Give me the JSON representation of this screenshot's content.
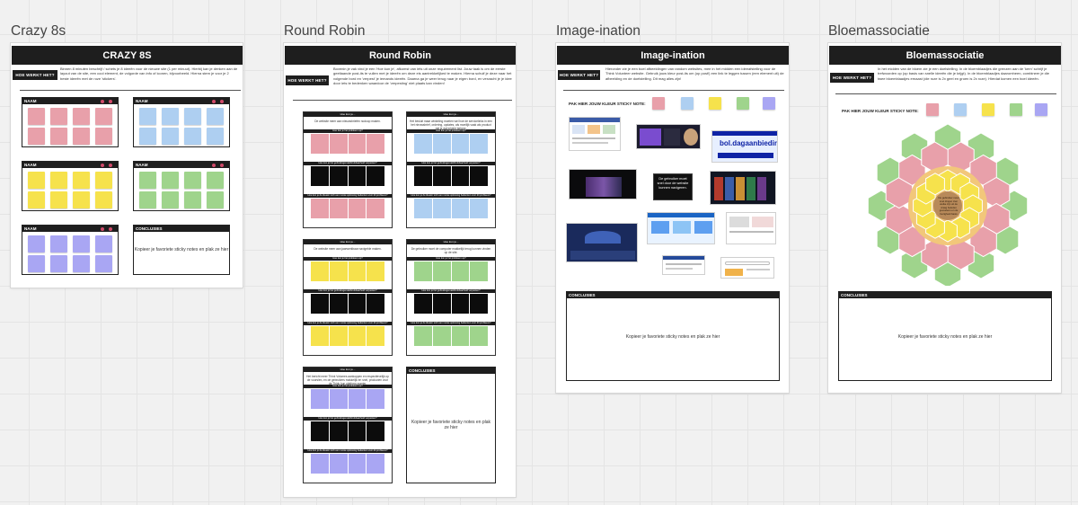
{
  "frames": {
    "crazy8s": {
      "title": "Crazy 8s",
      "header": "CRAZY 8S",
      "how_label": "HOE WERKT HET?",
      "description": "Binnen 8 minuten beschrijf / schets je 8 ideeën voor de nieuwe site (1 per minuut). Hierbij kan je denken aan de layout van de site, een cool element, de volgorde van info of iconen, bijvoorbeeld. Hierna stem je voor je 2 beste ideeën met de roze 'stickers'.",
      "cluster_label": "NAAM",
      "conclusions_label": "CONCLUSIES",
      "conclusions_text": "Kopieer je favoriete sticky notes en plak ze hier"
    },
    "roundrobin": {
      "title": "Round Robin",
      "header": "Round Robin",
      "how_label": "HOE WERKT HET?",
      "description": "Bovenin je vak vind je een 'Hoe kun je', afkomst van iets uit onze requirement list. Jouw taak is om de eerste geeltaande post-its te vullen met je ideeën om deze eis aantrekkelijked te maken. Hierna schuif je deze naar het volgende bord en 'verpest' je iemands ideeën. Daarna ga je weer terug naar je eigen bord, en verzacht je je idee door iets te bedenken waardoor de 'verpesting' niet plaats kan vinden!",
      "card_title": "Hoe kun je...",
      "row_labels": [
        "Hoe kun je het probleem op?",
        "Hoe kun je het gebruiksgemak/bruikbaarheid verpesten?",
        "Hoe kun je de ideeën toch een mooie oplossing bedenken voor dit probleem?"
      ],
      "cards": [
        {
          "question": "De website meer aan nieuwsbriefen nodoop maken."
        },
        {
          "question": "Het besluit maar winkeling moeten wel hoe de servicelinks in een het nieuwsbrief, ordering, updates, als moeilijk vaak als product dat je dat inhield beheer."
        },
        {
          "question": "De website meer aan jaarwerkbaar navigeble maken."
        },
        {
          "question": "De gebruiker moet de computer makkelijk terug kunnen vinden op de site."
        },
        {
          "question": "Het bericht meer Think Volumes aankoppen en respectievelijk op de voorslen, en de gebruikers makkelijk en snel, producten voor de Think hun platform manier."
        }
      ],
      "conclusions_label": "CONCLUSIES",
      "conclusions_text": "Kopieer je favoriete sticky notes en plak ze hier"
    },
    "imagination": {
      "title": "Image-ination",
      "header": "Image-ination",
      "how_label": "HOE WERKT HET?",
      "description": "Hieronder zie je een boel afbeeldingen van random websites, mee in het midden een ideeafstelling voor de Think Volunteer website. Gebruik jouw kleur post-its om (op post!) een link te leggen tussen (een element uit) de afbeelding en de doelstelling. Dit mag alles zijn!",
      "pick_label": "PAK HIER JOUW KLEUR STICKY NOTE:",
      "center_text": "De gebruiker moet snel door de website kunnen navigeren.",
      "thumbs": [
        "shop",
        "fashion",
        "bol.dagaanbieding",
        "iPhone",
        "netflix",
        "disney+",
        "booking",
        "deals",
        "news",
        "search",
        "shop2"
      ],
      "bol_label": "bol.dagaanbieding",
      "conclusions_label": "CONCLUSIES",
      "conclusions_text": "Kopieer je favoriete sticky notes en plak ze hier"
    },
    "bloem": {
      "title": "Bloemassociatie",
      "header": "Bloemassociatie",
      "how_label": "HOE WERKT HET?",
      "description": "In het midden van de bloem zie je een doelstelling. In de bloemblaadjes die grenzen aan de 'kern' schrijf je trefwoorden op (op basis van snelle ideeën die je krijgt). In de bloemblaadjes daaromheen, combineer je die twee bloemblaadjes ernaast (die roze is 2x geel en groen is 2x roze). Hierdat komen een boel ideeën.",
      "pick_label": "PAK HIER JOUW KLEUR STICKY NOTE:",
      "center_text": "De gebruiker moet snel dingen zien welke zijn uit de vraag beleden gevoelens en de bezigheid basis",
      "conclusions_label": "CONCLUSIES",
      "conclusions_text": "Kopieer je favoriete sticky notes en plak ze hier"
    }
  },
  "colors": {
    "pink": "#e8a0aa",
    "blue": "#aecff1",
    "yellow": "#f6e24c",
    "green": "#9fd48c",
    "purple": "#a9a6f3",
    "dark": "#1e1e1e",
    "petal_outer_green": "#9fd48c",
    "petal_pink": "#e8a0aa",
    "petal_yellow": "#f6e24c",
    "core": "#b88a5a"
  }
}
